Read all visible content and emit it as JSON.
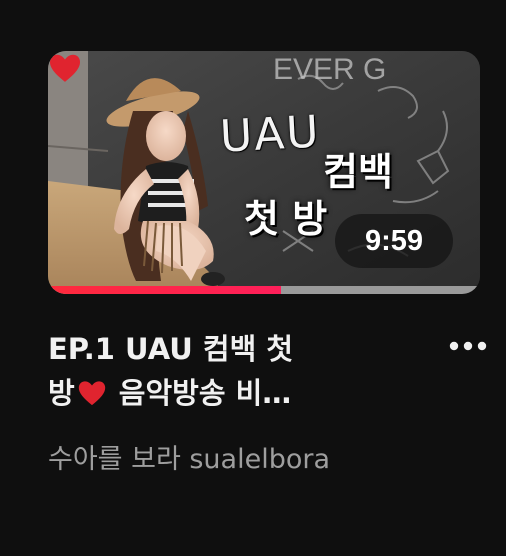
{
  "video": {
    "thumbnail": {
      "overlay_line1": "UAU",
      "overlay_line1b": "컴백",
      "overlay_line2": "첫 방",
      "chalkboard_text": "EVER G",
      "duration": "9:59",
      "watched_fraction": 0.54
    },
    "title": {
      "line1": "EP.1 UAU 컴백 첫",
      "line2_before_heart": "방",
      "line2_after_heart": " 음악방송 비…",
      "full": "EP.1 UAU 컴백 첫 방❤️ 음악방송 비…"
    },
    "channel": "수아를 보라 sualelbora",
    "icons": {
      "more": "more-vert-dots-icon",
      "heart": "red-heart-icon"
    }
  },
  "colors": {
    "background": "#0f0f0f",
    "title_text": "#f1f1f1",
    "channel_text": "#9e9e9e",
    "progress": "#ff2a3c",
    "heart": "#e0242f"
  }
}
